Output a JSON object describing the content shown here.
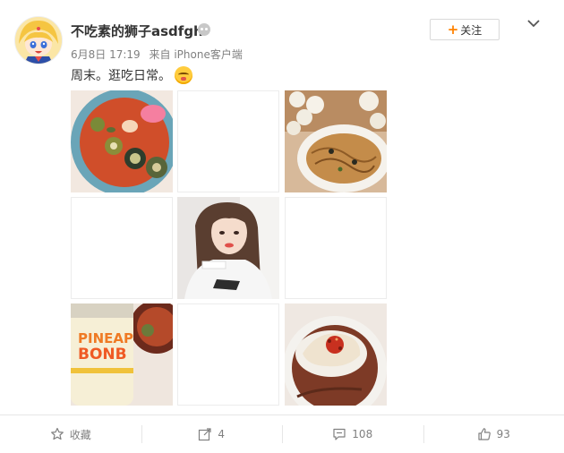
{
  "post": {
    "username": "不吃素的狮子asdfgh",
    "date": "6月8日 17:19",
    "source": "来自 iPhone客户端",
    "text": "周末。逛吃日常。",
    "emoji_icon": "blush-emoji-icon"
  },
  "follow": {
    "label": "关注"
  },
  "photos": [
    {
      "name": "photo-cold-noodle-soup",
      "type": "filled"
    },
    {
      "name": "photo-blank",
      "type": "blank"
    },
    {
      "name": "photo-dumplings-noodles",
      "type": "filled"
    },
    {
      "name": "photo-blank",
      "type": "blank"
    },
    {
      "name": "photo-selfie",
      "type": "filled"
    },
    {
      "name": "photo-blank",
      "type": "blank"
    },
    {
      "name": "photo-pineapple-drink",
      "type": "filled"
    },
    {
      "name": "photo-blank",
      "type": "blank"
    },
    {
      "name": "photo-dumpling-spoon",
      "type": "filled"
    }
  ],
  "actions": {
    "favorite_label": "收藏",
    "repost_count": "4",
    "comment_count": "108",
    "like_count": "93"
  },
  "colors": {
    "accent": "#ff8200",
    "text": "#333333",
    "meta": "#808080"
  }
}
